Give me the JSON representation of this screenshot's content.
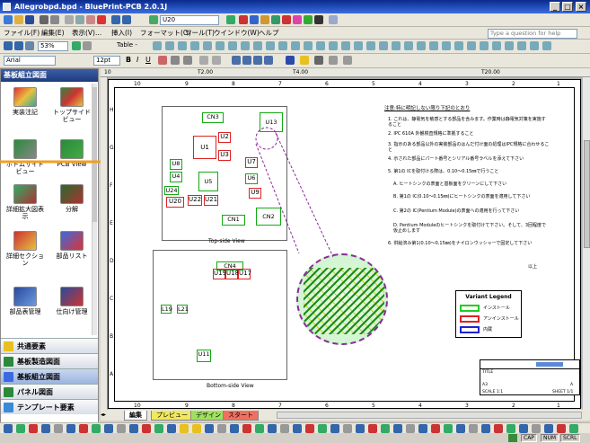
{
  "window": {
    "title": "Allegrobpd.bpd - BluePrint-PCB 2.0.1J"
  },
  "toolbar1": {
    "zoom_select": "U20"
  },
  "menubar": {
    "items": [
      "ファイル(F)",
      "編集(E)",
      "表示(V)...",
      "挿入(I)",
      "フォーマット(O)",
      "ツール(T)",
      "ウインドウ(W)",
      "ヘルプ"
    ],
    "help_placeholder": "Type a question for help"
  },
  "toolbar2": {
    "zoom": "53%",
    "table_label": "Table -"
  },
  "toolbar3": {
    "font": "Arial",
    "size": "12pt"
  },
  "sidebar": {
    "title": "基板組立図面",
    "tools": [
      {
        "label": "実装注記"
      },
      {
        "label": "トップサイドビュー"
      },
      {
        "label": "ボトムサイドビュー"
      },
      {
        "label": "PCB View"
      },
      {
        "label": "詳細拡大図表示"
      },
      {
        "label": "分解"
      },
      {
        "label": "詳細セクション"
      },
      {
        "label": "部品リスト"
      },
      {
        "label": "部品表管理"
      },
      {
        "label": "仕向け管理"
      }
    ],
    "sections": [
      "共通要素",
      "基板製造図面",
      "基板組立図面",
      "パネル図面",
      "テンプレート要素"
    ]
  },
  "ruler": {
    "marks": [
      "10",
      "T2.00",
      "T4.00",
      "T20.00"
    ]
  },
  "drawing": {
    "col_numbers": [
      "10",
      "9",
      "8",
      "7",
      "6",
      "5",
      "4",
      "3",
      "2",
      "1"
    ],
    "row_letters": [
      "H",
      "G",
      "F",
      "E",
      "D",
      "C",
      "B",
      "A"
    ],
    "top_view_label": "Top-side View",
    "bottom_view_label": "Bottom-side View",
    "top_components": [
      "CN3",
      "U13",
      "U1",
      "U2",
      "U3",
      "U5",
      "U4",
      "U8",
      "U24",
      "U20",
      "U22",
      "U21",
      "CN1",
      "CN2",
      "U7",
      "U6",
      "U9"
    ],
    "bottom_components": [
      "CN4",
      "U19",
      "U18",
      "U17",
      "L19",
      "L21",
      "U11"
    ],
    "notes_title": "注意:特に明記しない限り下記のとおり",
    "notes": [
      "1. これは、静電気を敏感とする部品を含みます。作業時は静電気対策を実施すること",
      "2. IPC 610A 外観検査規格に準拠すること",
      "3. 指示のある部品以外の実装部品のはんだ付け面の処理はIPC規格に合わせること",
      "4. 示された部品にパート番号とシリアル番号ラベルを添えて下さい",
      "5. 第1の ICを取付ける際は、0.10〜0.15㎜で行うこと",
      "A. ヒートシンクの表面と基板面をクリーンにして下さい",
      "B. 第1の IC(0.10〜0.15㎜)にヒートシンクの表面を適用して下さい",
      "C. 第2の IC(Pentium Module)の表面への適用を行って下さい",
      "D. Pentium Moduleのヒートシンクを取付けて下さい。そして、3回程度で仮止めします",
      "6. 供給済み第1(0.10〜0.15㎜)をナイロンウッシャーで固定して下さい"
    ],
    "notes_end": "以上",
    "legend": {
      "title": "Variant Legend",
      "items": [
        {
          "label": "インストール",
          "color": "#22cc22"
        },
        {
          "label": "アンインストール",
          "color": "#dd2222"
        },
        {
          "label": "内蔵",
          "color": "#2222cc"
        }
      ]
    },
    "title_block": {
      "title_label": "TITLE",
      "size": "A3",
      "rev": "A",
      "scale": "SCALE 1:1",
      "sheet": "SHEET 1/1"
    }
  },
  "tabs": [
    "編集",
    "プレビュー",
    "デザイン",
    "スタート"
  ],
  "status": {
    "cap": "CAP",
    "num": "NUM",
    "scrl": "SCRL"
  }
}
